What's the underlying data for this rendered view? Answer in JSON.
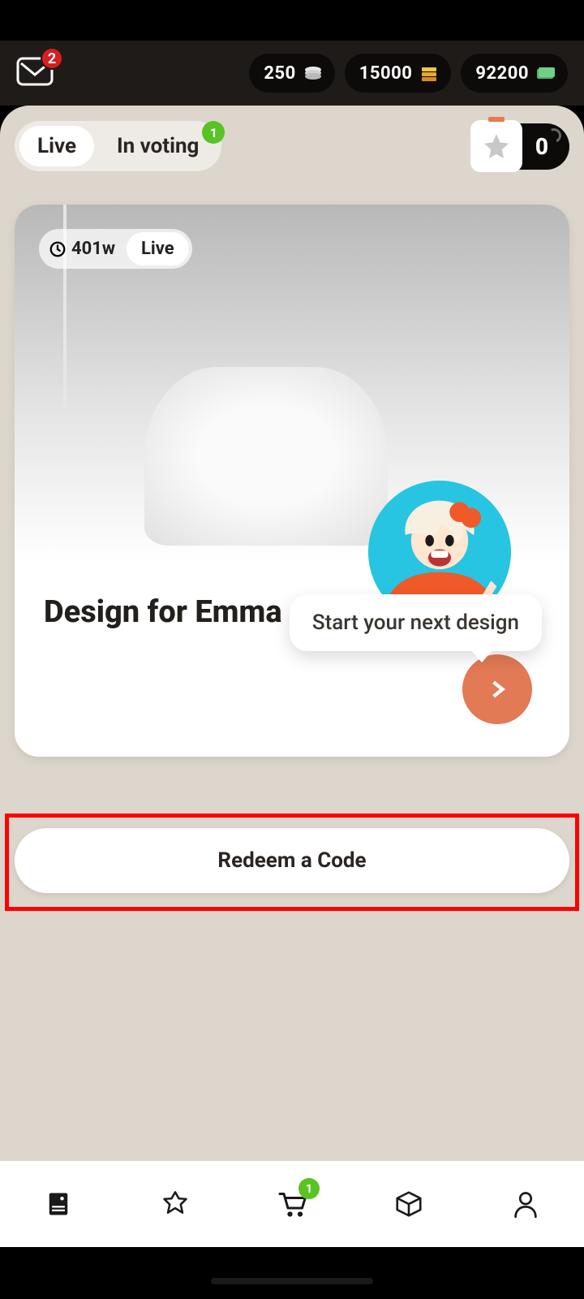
{
  "header": {
    "mail_badge": "2",
    "currencies": [
      {
        "value": "250",
        "icon": "coins-icon"
      },
      {
        "value": "15000",
        "icon": "gold-icon"
      },
      {
        "value": "92200",
        "icon": "cash-icon"
      }
    ]
  },
  "tabs": {
    "live_label": "Live",
    "voting_label": "In voting",
    "voting_badge": "1",
    "trophy_score": "0"
  },
  "card": {
    "time_label": "401w",
    "status_label": "Live",
    "title": "Design for Emma",
    "tooltip": "Start your next design"
  },
  "redeem": {
    "label": "Redeem a Code"
  },
  "bottomnav": {
    "cart_badge": "1"
  }
}
